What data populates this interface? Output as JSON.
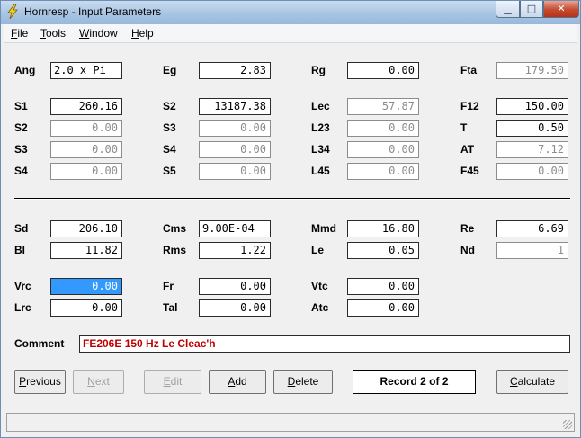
{
  "window": {
    "title": "Hornresp - Input Parameters"
  },
  "menu": [
    {
      "accel": "F",
      "rest": "ile"
    },
    {
      "accel": "T",
      "rest": "ools"
    },
    {
      "accel": "W",
      "rest": "indow"
    },
    {
      "accel": "H",
      "rest": "elp"
    }
  ],
  "params": {
    "ang": {
      "label": "Ang",
      "value": "2.0 x Pi"
    },
    "eg": {
      "label": "Eg",
      "value": "2.83"
    },
    "rg": {
      "label": "Rg",
      "value": "0.00"
    },
    "fta": {
      "label": "Fta",
      "value": "179.50"
    },
    "s1": {
      "label": "S1",
      "value": "260.16"
    },
    "s2b": {
      "label": "S2",
      "value": "13187.38"
    },
    "lec": {
      "label": "Lec",
      "value": "57.87"
    },
    "f12": {
      "label": "F12",
      "value": "150.00"
    },
    "s2": {
      "label": "S2",
      "value": "0.00"
    },
    "s3b": {
      "label": "S3",
      "value": "0.00"
    },
    "l23": {
      "label": "L23",
      "value": "0.00"
    },
    "t": {
      "label": "T",
      "value": "0.50"
    },
    "s3": {
      "label": "S3",
      "value": "0.00"
    },
    "s4b": {
      "label": "S4",
      "value": "0.00"
    },
    "l34": {
      "label": "L34",
      "value": "0.00"
    },
    "at": {
      "label": "AT",
      "value": "7.12"
    },
    "s4": {
      "label": "S4",
      "value": "0.00"
    },
    "s5": {
      "label": "S5",
      "value": "0.00"
    },
    "l45": {
      "label": "L45",
      "value": "0.00"
    },
    "f45": {
      "label": "F45",
      "value": "0.00"
    },
    "sd": {
      "label": "Sd",
      "value": "206.10"
    },
    "cms": {
      "label": "Cms",
      "value": "9.00E-04"
    },
    "mmd": {
      "label": "Mmd",
      "value": "16.80"
    },
    "re": {
      "label": "Re",
      "value": "6.69"
    },
    "bl": {
      "label": "Bl",
      "value": "11.82"
    },
    "rms": {
      "label": "Rms",
      "value": "1.22"
    },
    "le": {
      "label": "Le",
      "value": "0.05"
    },
    "nd": {
      "label": "Nd",
      "value": "1"
    },
    "vrc": {
      "label": "Vrc",
      "value": "0.00"
    },
    "fr": {
      "label": "Fr",
      "value": "0.00"
    },
    "vtc": {
      "label": "Vtc",
      "value": "0.00"
    },
    "lrc": {
      "label": "Lrc",
      "value": "0.00"
    },
    "tal": {
      "label": "Tal",
      "value": "0.00"
    },
    "atc": {
      "label": "Atc",
      "value": "0.00"
    }
  },
  "comment": {
    "label": "Comment",
    "value": "FE206E 150 Hz Le Cleac'h"
  },
  "buttons": {
    "previous": {
      "accel": "P",
      "rest": "revious"
    },
    "next": {
      "accel": "N",
      "rest": "ext"
    },
    "edit": {
      "accel": "E",
      "rest": "dit"
    },
    "add": {
      "accel": "A",
      "rest": "dd"
    },
    "delete": {
      "accel": "D",
      "rest": "elete"
    },
    "calculate": {
      "accel": "C",
      "rest": "alculate"
    }
  },
  "record": "Record 2 of 2",
  "colors": {
    "titlebar": "#a8c4e2",
    "comment_text": "#c00000",
    "selection": "#3399ff"
  }
}
